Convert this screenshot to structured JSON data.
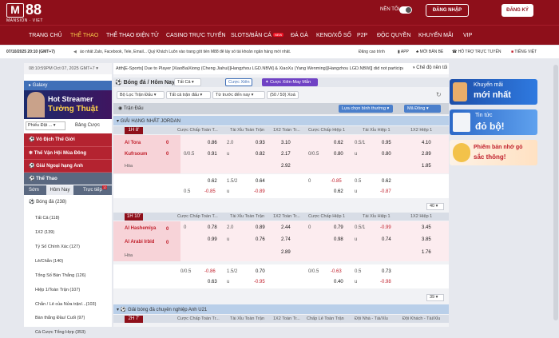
{
  "header": {
    "logo_mark": "M",
    "logo_num": "88",
    "logo_sub": "MANSION · VIET",
    "dark_mode_label": "NỀN TỐI",
    "login": "ĐĂNG NHẬP",
    "register": "ĐĂNG KÝ"
  },
  "nav": [
    {
      "label": "TRANG CHỦ"
    },
    {
      "label": "THỂ THAO"
    },
    {
      "label": "THỂ THAO ĐIỆN TỬ"
    },
    {
      "label": "CASINO TRỰC TUYẾN"
    },
    {
      "label": "SLOTS/BẮN CÁ"
    },
    {
      "label": "ĐÁ GÀ"
    },
    {
      "label": "KENO/XỔ SỐ"
    },
    {
      "label": "P2P"
    },
    {
      "label": "ĐỘC QUYỀN"
    },
    {
      "label": "KHUYẾN MÃI"
    },
    {
      "label": "VIP"
    }
  ],
  "nav_new_badge": "NEW",
  "subbar": {
    "datetime": "07/10/2025 20:10 (GMT+7)",
    "marquee": "ào nhất Zalo, Facebook, Tele, Email... Quý Khách Luôn vào trang gốt tiền M88 để lấy số tài khoản ngân hàng mới nhất.",
    "marquee2": "Đăng cao trình",
    "app": "APP",
    "new_bet": "MỚI BẢN BÈ",
    "support": "HỖ TRỢ TRỰC TUYẾN",
    "lang": "TIẾNG VIỆT"
  },
  "sidebar": {
    "clock": "08:10:59PM Oct 07, 2025 GMT+7",
    "galaxy": "Galaxy",
    "banner1": "Hot Streamer",
    "banner2": "Tường Thuật",
    "filter": "Phiếu Đặt ...",
    "bet_tab": "Bảng Cược",
    "menu": [
      {
        "label": "Vô Địch Thế Giới"
      },
      {
        "label": "Thế Vận Hội Mùa Đông"
      },
      {
        "label": "Giải Ngoại hạng Anh"
      },
      {
        "label": "Thể Thao"
      }
    ],
    "sub_tabs": [
      "Sớm",
      "Hôm Nay",
      "Trực tiếp"
    ],
    "live_count": "12",
    "sport_label": "Bóng đá",
    "sport_count": "(238)",
    "items": [
      {
        "label": "Tất Cả (118)"
      },
      {
        "label": "1X2 (139)"
      },
      {
        "label": "Tỷ Số Chính Xác (127)"
      },
      {
        "label": "Lẻ/Chẵn (140)"
      },
      {
        "label": "Tổng Số Bàn Thắng (126)"
      },
      {
        "label": "Hiệp 1/Toàn Trận (107)"
      },
      {
        "label": "Chẵn / Lẻ của Nửa trận/...(103)"
      },
      {
        "label": "Bàn thắng Đầu/ Cuối (97)"
      },
      {
        "label": "Cá Cược Tổng Hợp (353)"
      }
    ]
  },
  "main": {
    "announce_prefix": "Atth[E-Sports] Due to Player [XiaoBaiXiong (Cheng Jiahui)]Hangzhou LGD.NBW] & XiaoXu (Yang Wenming)[Hangzhou LGD.NBW]] did not participate, [Cing",
    "dark_label": "Chế độ nền tối",
    "tab_sport": "Bóng đá / Hôm Nay",
    "tab_all": "Tất Cả",
    "btn_bet": "Cược Xiên",
    "btn_mymarket": "Cược Xiên-May Mắn",
    "filter_league": "Bộ Lọc Trận Đấu",
    "filter_bet_type": "Tất cả trận đấu",
    "filter_sort": "Từ trước đến nay",
    "filter_count": "(50 / 50) Xoá",
    "section_label": "Trận Đấu",
    "sort_label": "Lựa chọn bình thường",
    "odds_label": "Mã Đông",
    "league1": "GIẢI HẠNG NHẤT JORDAN",
    "league2": "Giải bóng đá chuyên nghiệp Anh U21",
    "col_heads": [
      "Cược Chấp Toàn T...",
      "Tài Xỉu Toàn Trận",
      "1X2 Toàn Tr...",
      "Cược Chấp Hiệp 1",
      "Tài Xỉu Hiệp 1",
      "1X2 Hiệp 1"
    ],
    "col_heads2": [
      "Cược Chấp Toàn Tr...",
      "Tài Xỉu Toàn Trận",
      "1X2 Toàn Tr...",
      "Chấp Lẻ Toàn Trận",
      "Đội Nhà - Tài/Xỉu",
      "Đội Khách - Tài/Xỉu"
    ],
    "more1": "40",
    "more2": "39",
    "matches": [
      {
        "time": "1H 8'",
        "home": "Al Tora",
        "away": "Kufrsoum",
        "draw": "Hòa",
        "home_score": "0",
        "away_score": "0",
        "rows": [
          [
            "",
            "0.86",
            "2.0",
            "0.93",
            "3.10",
            "",
            "0.62",
            "0.5/1",
            "0.95",
            "4.10"
          ],
          [
            "0/0.5",
            "0.91",
            "u",
            "0.82",
            "2.17",
            "0/0.5",
            "0.80",
            "u",
            "0.80",
            "2.89"
          ],
          [
            "",
            "",
            "",
            "",
            "2.92",
            "",
            "",
            "",
            "",
            "1.85"
          ]
        ],
        "extra": [
          [
            "",
            "0.62",
            "1.5/2",
            "0.64",
            "",
            "0",
            "-0.85",
            "0.5",
            "0.62",
            ""
          ],
          [
            "0.5",
            "-0.85",
            "u",
            "-0.89",
            "",
            "",
            "0.62",
            "u",
            "-0.87",
            ""
          ]
        ]
      },
      {
        "time": "1H 10'",
        "home": "Al Hashemiya",
        "away": "Al Arabi Irbid",
        "draw": "Hòa",
        "home_score": "0",
        "away_score": "0",
        "rows": [
          [
            "0",
            "0.78",
            "2.0",
            "0.89",
            "2.44",
            "0",
            "0.79",
            "0.5/1",
            "-0.99",
            "3.45"
          ],
          [
            "",
            "0.99",
            "u",
            "0.76",
            "2.74",
            "",
            "0.98",
            "u",
            "0.74",
            "3.85"
          ],
          [
            "",
            "",
            "",
            "",
            "2.89",
            "",
            "",
            "",
            "",
            "1.76"
          ]
        ],
        "extra": [
          [
            "0/0.5",
            "-0.86",
            "1.5/2",
            "0.70",
            "",
            "0/0.5",
            "-0.63",
            "0.5",
            "0.73",
            ""
          ],
          [
            "",
            "0.63",
            "u",
            "-0.95",
            "",
            "",
            "0.40",
            "u",
            "-0.98",
            ""
          ]
        ]
      }
    ],
    "match3_time": "2H 7'"
  },
  "rside": {
    "promo1_a": "Khuyến mãi",
    "promo1_b": "mới nhất",
    "promo2_a": "Tin tức",
    "promo2_b": "đỏ bộ!",
    "promo3_a": "Phiếm bản nhớ gỏ",
    "promo3_b": "sắc thông!"
  },
  "colors": {
    "brand": "#8e0f1a",
    "league_blue": "#b9cfe9",
    "team_pink": "#f7d3d8"
  }
}
